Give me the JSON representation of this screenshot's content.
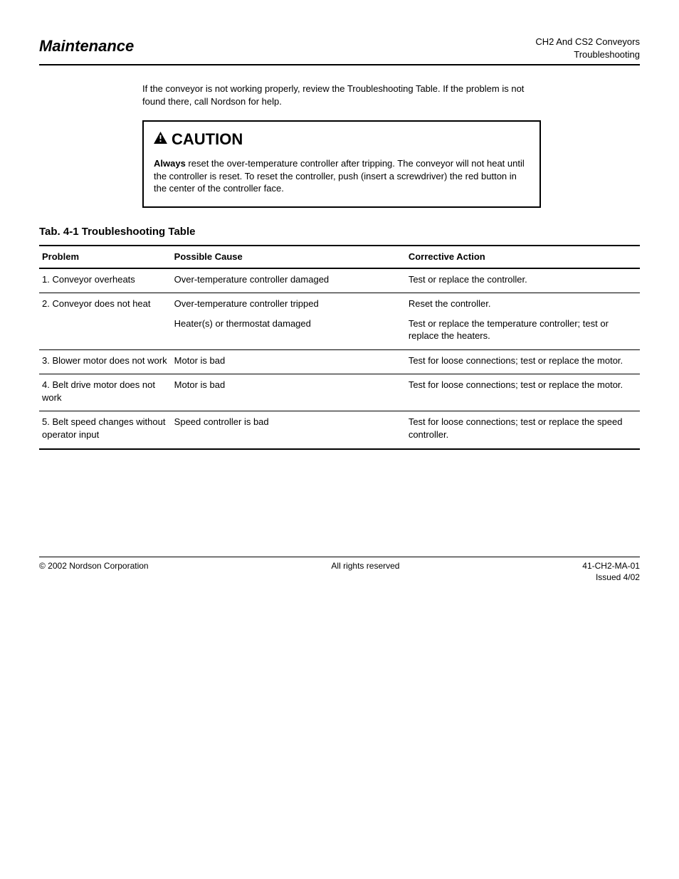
{
  "header": {
    "left": "Maintenance",
    "right_line1": "CH2 And CS2 Conveyors",
    "right_line2": "Troubleshooting"
  },
  "intro": "If the conveyor is not working properly, review the Troubleshooting Table. If the problem is not found there, call Nordson for help.",
  "caution": {
    "title": "CAUTION",
    "body_strong": "Always",
    "body_rest": " reset the over-temperature controller after tripping. The conveyor will not heat until the controller is reset. To reset the controller, push (insert a screwdriver) the red button in the center of the controller face."
  },
  "table_title": "Tab. 4-1  Troubleshooting Table",
  "columns": [
    "Problem",
    "Possible Cause",
    "Corrective Action"
  ],
  "rows": [
    {
      "problem": "1. Conveyor overheats",
      "cause_lines": [
        "Over-temperature controller damaged"
      ],
      "action_lines": [
        "Test or replace the controller."
      ]
    },
    {
      "problem": "2. Conveyor does not heat",
      "cause_lines": [
        "Over-temperature controller tripped",
        "Heater(s) or thermostat damaged"
      ],
      "action_lines": [
        "Reset the controller.",
        "Test or replace the temperature controller; test or replace the heaters."
      ]
    },
    {
      "problem": "3. Blower motor does not work",
      "cause_lines": [
        "Motor is bad"
      ],
      "action_lines": [
        "Test for loose connections; test or replace the motor."
      ]
    },
    {
      "problem": "4. Belt drive motor does not work",
      "cause_lines": [
        "Motor is bad"
      ],
      "action_lines": [
        "Test for loose connections; test or replace the motor."
      ]
    },
    {
      "problem": "5. Belt speed changes without operator input",
      "cause_lines": [
        "Speed controller is bad"
      ],
      "action_lines": [
        "Test for loose connections; test or replace the speed controller."
      ]
    }
  ],
  "footer": {
    "left": "© 2002 Nordson Corporation",
    "center": "All rights reserved",
    "right_top": "41-CH2-MA-01",
    "right_bottom": "Issued 4/02"
  }
}
